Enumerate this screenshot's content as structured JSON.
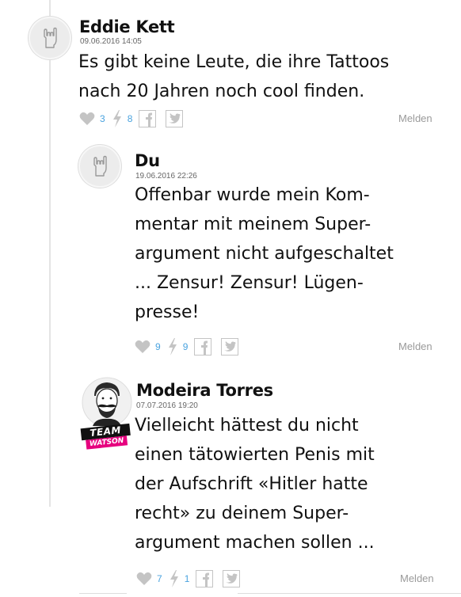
{
  "comments": [
    {
      "author": "Eddie Kett",
      "timestamp": "09.06.2016 14:05",
      "lines": [
        "Es gibt keine Leute, die ihre Tattoos",
        "nach 20 Jahren noch cool finden."
      ],
      "likes": "3",
      "bolts": "8",
      "report_label": "Melden"
    },
    {
      "author": "Du",
      "timestamp": "19.06.2016 22:26",
      "lines": [
        "Offenbar wurde mein Kom-",
        "mentar mit meinem Super-",
        "argument nicht aufgeschaltet",
        "... Zensur! Zensur! Lügen-",
        "presse!"
      ],
      "likes": "9",
      "bolts": "9",
      "report_label": "Melden"
    },
    {
      "author": "Modeira Torres",
      "timestamp": "07.07.2016 19:20",
      "badge": {
        "line1": "TEAM",
        "line2": "WATSON"
      },
      "lines": [
        "Vielleicht hättest du nicht",
        "einen tätowierten Penis mit",
        "der Aufschrift «Hitler hatte",
        "recht» zu deinem Super-",
        "argument machen sollen ..."
      ],
      "likes": "7",
      "bolts": "1",
      "report_label": "Melden"
    }
  ],
  "icons": {
    "like": "heart-icon",
    "bolt": "lightning-icon",
    "facebook": "facebook-icon",
    "twitter": "twitter-icon",
    "avatar_default": "rock-hand-icon"
  },
  "colors": {
    "count": "#4aa3df",
    "icon": "#c4c4c4",
    "brand_pink": "#e6007e"
  }
}
